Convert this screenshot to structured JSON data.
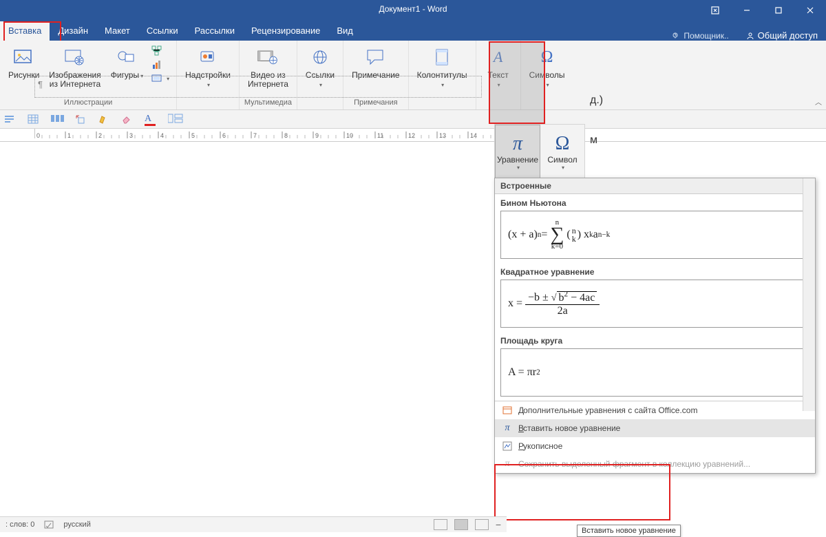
{
  "title": "Документ1 - Word",
  "tabs": [
    "Вставка",
    "Дизайн",
    "Макет",
    "Ссылки",
    "Рассылки",
    "Рецензирование",
    "Вид"
  ],
  "tell_me": "Помощник..",
  "share": "Общий доступ",
  "ribbon": {
    "illustrations": {
      "pictures": "Рисунки",
      "online_pictures": "Изображения\nиз Интернета",
      "shapes": "Фигуры",
      "label": "Иллюстрации"
    },
    "addins": {
      "addins": "Надстройки",
      "label": ""
    },
    "media": {
      "online_video": "Видео из\nИнтернета",
      "label": "Мультимедиа"
    },
    "links": {
      "links": "Ссылки",
      "label": ""
    },
    "comments": {
      "comment": "Примечание",
      "label": "Примечания"
    },
    "header_footer": {
      "hf": "Колонтитулы",
      "label": ""
    },
    "text": {
      "text": "Текст",
      "label": ""
    },
    "symbols": {
      "symbols": "Символы",
      "label": ""
    }
  },
  "gallery": {
    "equation": "Уравнение",
    "symbol": "Символ"
  },
  "dropdown": {
    "header": "Встроенные",
    "items": [
      {
        "title": "Бином Ньютона"
      },
      {
        "title": "Квадратное уравнение"
      },
      {
        "title": "Площадь круга"
      }
    ],
    "more": "Дополнительные уравнения с сайта Office.com",
    "insert_new": "Вставить новое уравнение",
    "ink": "Рукописное",
    "save_sel": "Сохранить выделенный фрагмент в коллекцию уравнений..."
  },
  "tooltip": "Вставить новое уравнение",
  "status": {
    "words_lbl": "слов:",
    "words": "0",
    "lang": "русский"
  },
  "behind": {
    "r1": "д.)",
    "r2": "м"
  }
}
